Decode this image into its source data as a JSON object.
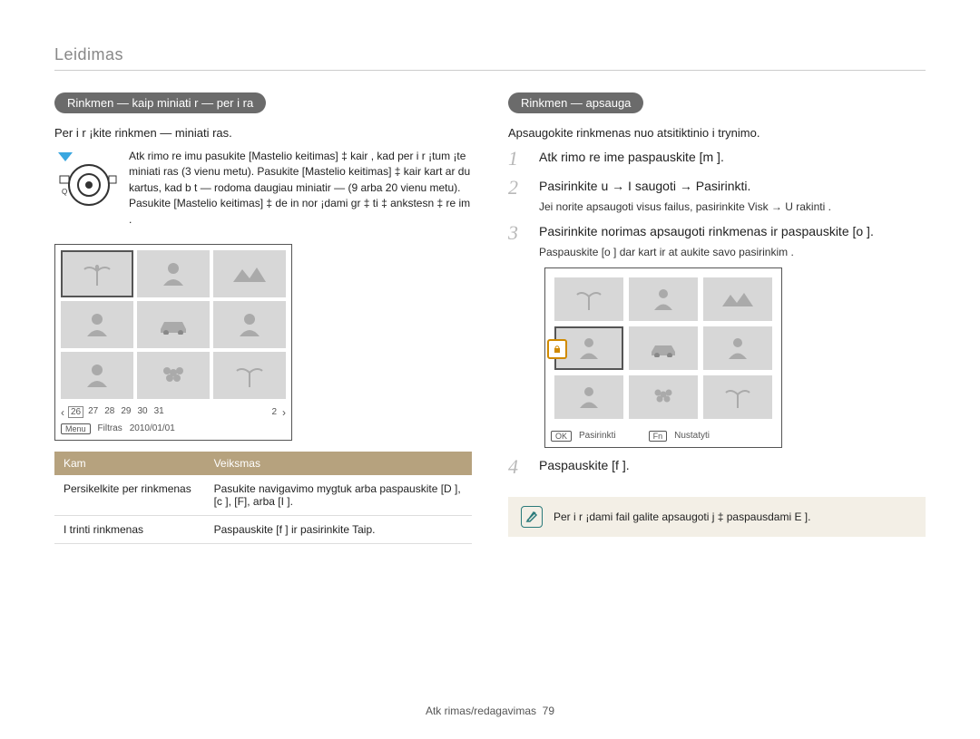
{
  "header": {
    "title": "Leidimas"
  },
  "left": {
    "pill": "Rinkmen — kaip miniati r — per i ra",
    "lead": "Per i r ¡kite rinkmen — miniati ras.",
    "dial_para": "Atk rimo re imu pasukite [Mastelio keitimas] ‡ kair , kad per i r ¡tum ¡te miniati ras (3 vienu metu). Pasukite [Mastelio keitimas] ‡ kair kart ar du kartus, kad b t — rodoma daugiau miniatir — (9 arba 20 vienu metu). Pasukite [Mastelio keitimas] ‡ de in nor ¡dami gr ‡ ti ‡ ankstesn ‡ re im .",
    "date_strip": {
      "days_left": [
        "26",
        "27",
        "28",
        "29",
        "30",
        "31"
      ],
      "count_right": "2"
    },
    "menu_strip": {
      "menu_btn": "Menu",
      "filter_label": "Filtras",
      "date_text": "2010/01/01"
    },
    "table": {
      "head_left": "Kam",
      "head_right": "Veiksmas",
      "rows": [
        {
          "l": "Persikelkite per rinkmenas",
          "r": "Pasukite navigavimo mygtuk   arba paspauskite [D    ], [c ], [F], arba [I    ]."
        },
        {
          "l": "I trinti rinkmenas",
          "r": "Paspauskite [f   ] ir pasirinkite Taip."
        }
      ]
    }
  },
  "right": {
    "pill": "Rinkmen — apsauga",
    "lead": "Apsaugokite rinkmenas nuo atsitiktinio i trynimo.",
    "steps": {
      "s1": "Atk rimo re ime paspauskite [m    ].",
      "s2": "Pasirinkite u    → I saugoti → Pasirinkti.",
      "s2_sub": "Jei norite apsaugoti visus failus, pasirinkite Visk   → U rakinti .",
      "s3": "Pasirinkite norimas apsaugoti rinkmenas ir paspauskite [o ].",
      "s3_sub": "Paspauskite [o ] dar kart   ir at aukite savo pasirinkim .",
      "s4": "Paspauskite [f   ]."
    },
    "screen_buttons": {
      "ok_btn": "OK",
      "ok_label": "Pasirinkti",
      "fn_btn": "Fn",
      "fn_label": "Nustatyti"
    },
    "note": "Per i r ¡dami fail   galite apsaugoti j ‡ paspausdami E   ].",
    "note_icon": "note-icon"
  },
  "footer": {
    "text": "Atk rimas/redagavimas",
    "page": "79"
  }
}
